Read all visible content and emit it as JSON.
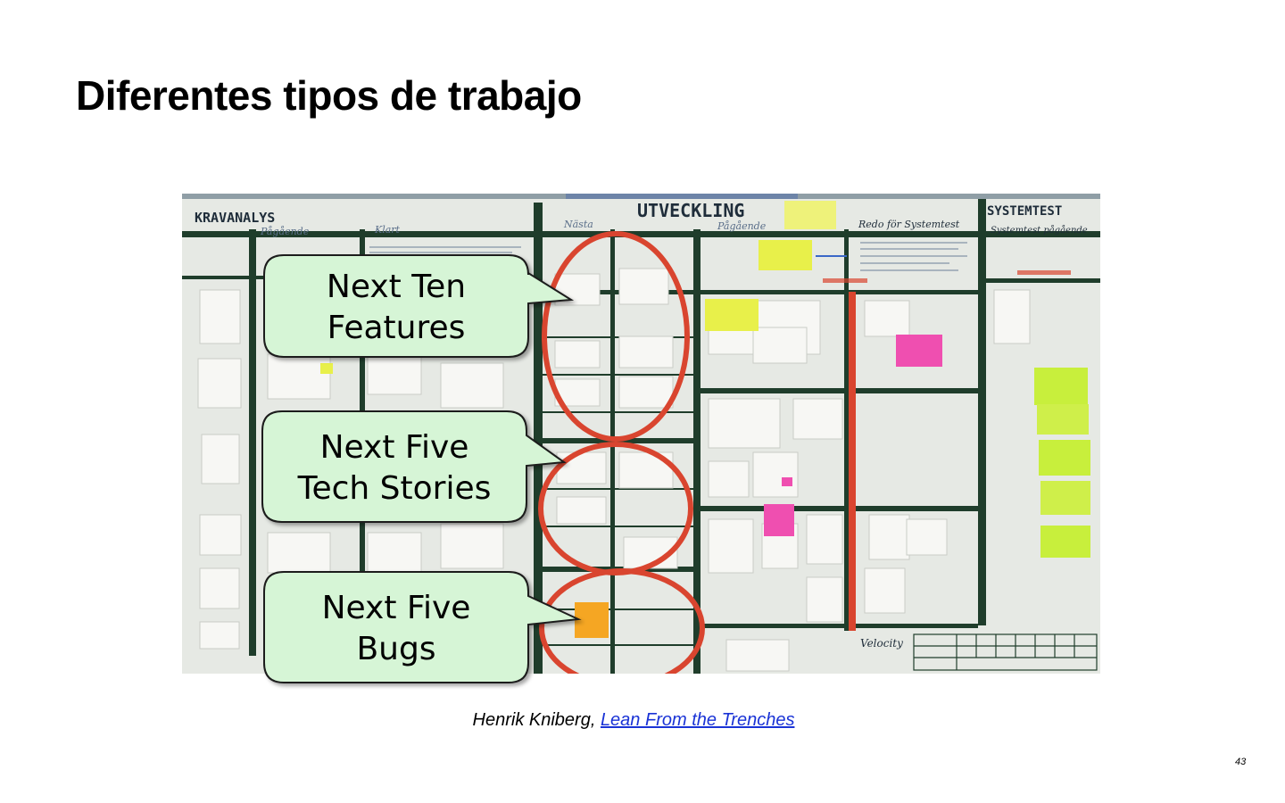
{
  "slide": {
    "title": "Diferentes tipos de trabajo",
    "page_number": "43"
  },
  "board": {
    "headers": {
      "kravanalys": "KRAVANALYS",
      "utveckling": "UTVECKLING",
      "systemtest": "SYSTEMTEST",
      "pagaende": "Pågående",
      "klart": "Klart",
      "nasta": "Nästa",
      "redo_for_systemtest": "Redo för Systemtest",
      "systemtest_pagaende": "Systemtest pågående",
      "velocity": "Velocity"
    }
  },
  "callouts": [
    {
      "line1": "Next Ten",
      "line2": "Features"
    },
    {
      "line1": "Next Five",
      "line2": "Tech Stories"
    },
    {
      "line1": "Next Five",
      "line2": "Bugs"
    }
  ],
  "caption": {
    "author": "Henrik Kniberg,",
    "link_text": "Lean From the Trenches"
  },
  "colors": {
    "callout_fill": "#d6f5d6",
    "highlight_ring": "#d9452f",
    "link": "#1a33d6",
    "board_line": "#1f3d2b",
    "sticky_yellow": "#e8f04a",
    "sticky_pink": "#ef4fb0",
    "sticky_orange": "#f5a623",
    "sticky_green": "#c8ef3c"
  }
}
